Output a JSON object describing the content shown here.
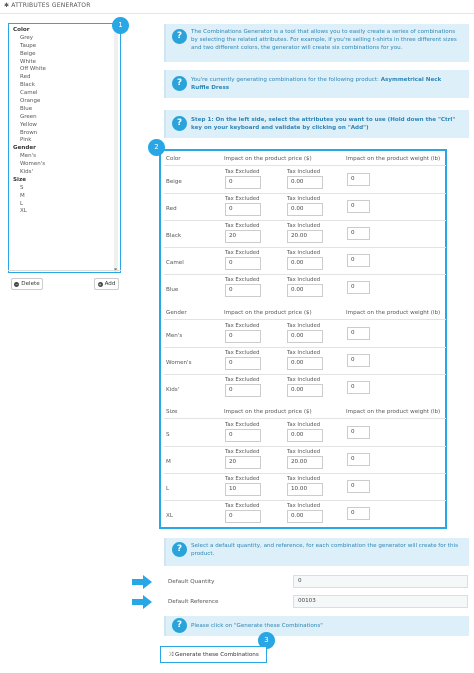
{
  "panel": {
    "title": "ATTRIBUTES GENERATOR"
  },
  "badges": [
    "1",
    "2",
    "3"
  ],
  "attribute_list": {
    "groups": [
      {
        "name": "Color",
        "values": [
          "Grey",
          "Taupe",
          "Beige",
          "White",
          "Off White",
          "Red",
          "Black",
          "Camel",
          "Orange",
          "Blue",
          "Green",
          "Yellow",
          "Brown",
          "Pink"
        ]
      },
      {
        "name": "Gender",
        "values": [
          "Men's",
          "Women's",
          "Kids'"
        ]
      },
      {
        "name": "Size",
        "values": [
          "S",
          "M",
          "L",
          "XL"
        ]
      }
    ],
    "delete_label": "Delete",
    "add_label": "Add"
  },
  "alerts": {
    "intro": "The Combinations Generator is a tool that allows you to easily create a series of combinations by selecting the related attributes. For example, if you're selling t-shirts in three different sizes and two different colors, the generator will create six combinations for you.",
    "product_prefix": "You're currently generating combinations for the following product:",
    "product_name": "Asymmetrical Neck Ruffle Dress",
    "step1": "Step 1: On the left side, select the attributes you want to use (Hold down the \"Ctrl\" key on your keyboard and validate by clicking on \"Add\")",
    "defaults": "Select a default quantity, and reference, for each combination the generator will create for this product.",
    "click": "Please click on \"Generate these Combinations\""
  },
  "table": {
    "price_header": "Impact on the product price ($)",
    "weight_header": "Impact on the product weight (lb)",
    "tax_excluded": "Tax Excluded",
    "tax_included": "Tax Included",
    "groups": [
      {
        "name": "Color",
        "rows": [
          {
            "label": "Beige",
            "excl": "0",
            "incl": "0.00",
            "weight": "0"
          },
          {
            "label": "Red",
            "excl": "0",
            "incl": "0.00",
            "weight": "0"
          },
          {
            "label": "Black",
            "excl": "20",
            "incl": "20.00",
            "weight": "0"
          },
          {
            "label": "Camel",
            "excl": "0",
            "incl": "0.00",
            "weight": "0"
          },
          {
            "label": "Blue",
            "excl": "0",
            "incl": "0.00",
            "weight": "0"
          }
        ]
      },
      {
        "name": "Gender",
        "rows": [
          {
            "label": "Men's",
            "excl": "0",
            "incl": "0.00",
            "weight": "0"
          },
          {
            "label": "Women's",
            "excl": "0",
            "incl": "0.00",
            "weight": "0"
          },
          {
            "label": "Kids'",
            "excl": "0",
            "incl": "0.00",
            "weight": "0"
          }
        ]
      },
      {
        "name": "Size",
        "rows": [
          {
            "label": "S",
            "excl": "0",
            "incl": "0.00",
            "weight": "0"
          },
          {
            "label": "M",
            "excl": "20",
            "incl": "20.00",
            "weight": "0"
          },
          {
            "label": "L",
            "excl": "10",
            "incl": "10.00",
            "weight": "0"
          },
          {
            "label": "XL",
            "excl": "0",
            "incl": "0.00",
            "weight": "0"
          }
        ]
      }
    ]
  },
  "defaults": {
    "quantity_label": "Default Quantity",
    "quantity_value": "0",
    "reference_label": "Default Reference",
    "reference_value": "00103"
  },
  "generate_label": "Generate these Combinations",
  "colors": {
    "accent": "#28a6e5",
    "alert_bg": "#ddf0f9",
    "alert_text": "#2c84b5"
  }
}
